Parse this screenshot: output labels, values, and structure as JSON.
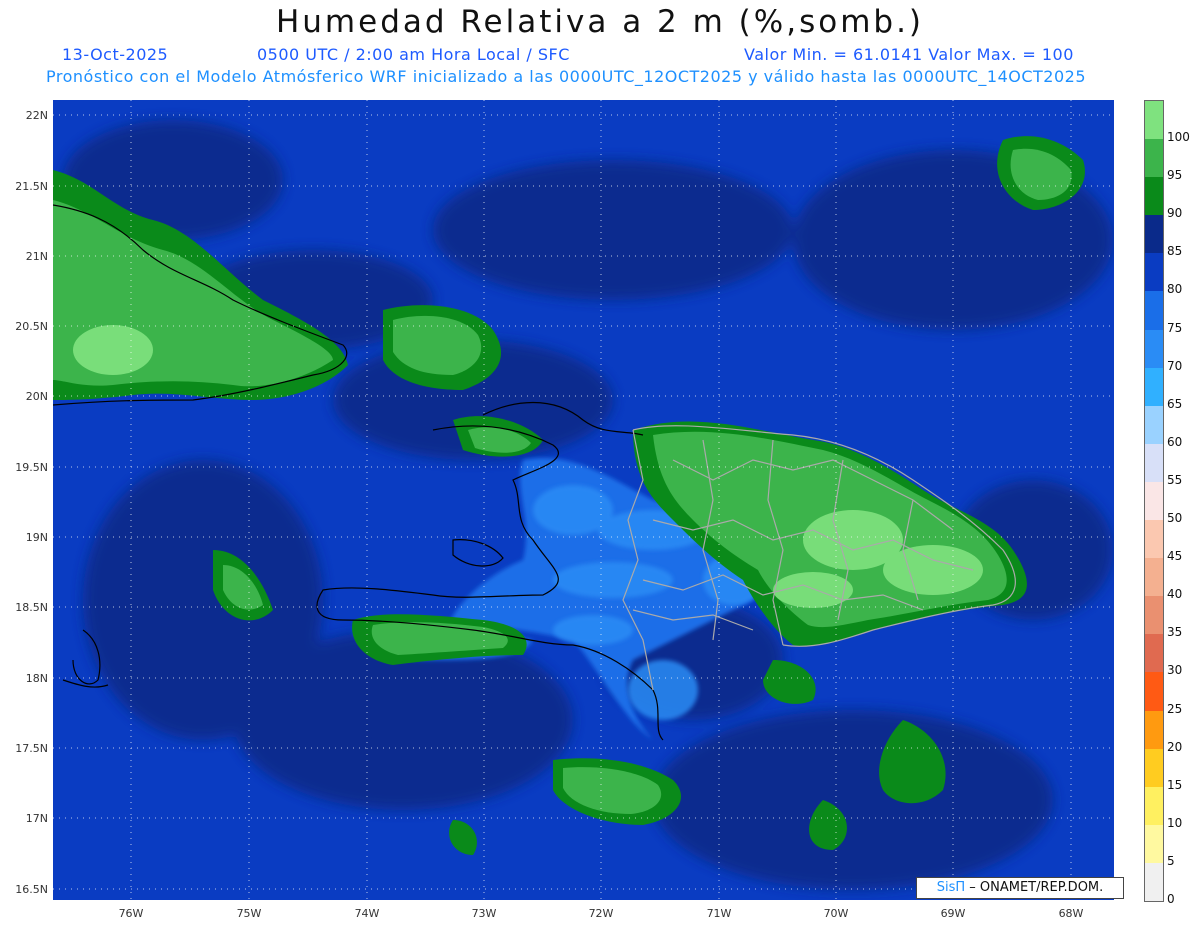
{
  "header": {
    "title": "Humedad Relativa a 2 m (%,somb.)",
    "date": "13-Oct-2025",
    "time_info": "0500 UTC / 2:00 am Hora Local / SFC",
    "min_max": "Valor Min. = 61.0141  Valor Max. = 100",
    "model_info": "Pronóstico con el Modelo Atmósferico WRF inicializado a las 0000UTC_12OCT2025 y válido hasta las  0000UTC_14OCT2025"
  },
  "axes": {
    "lat_labels": [
      "22N",
      "21.5N",
      "21N",
      "20.5N",
      "20N",
      "19.5N",
      "19N",
      "18.5N",
      "18N",
      "17.5N",
      "17N",
      "16.5N"
    ],
    "lon_labels": [
      "76W",
      "75W",
      "74W",
      "73W",
      "72W",
      "71W",
      "70W",
      "69W",
      "68W"
    ]
  },
  "legend": {
    "labels": [
      "100",
      "95",
      "90",
      "85",
      "80",
      "75",
      "70",
      "65",
      "60",
      "55",
      "50",
      "45",
      "40",
      "35",
      "30",
      "25",
      "20",
      "15",
      "10",
      "5",
      "0"
    ],
    "colors": [
      "#7fe27f",
      "#3cb44b",
      "#0a8a1a",
      "#0a2a8a",
      "#0a3cc2",
      "#1a6ee8",
      "#2a8cf5",
      "#30b0ff",
      "#9ad2ff",
      "#d8e0f8",
      "#fae6e6",
      "#fbc8b0",
      "#f4b090",
      "#ea9070",
      "#e06a50",
      "#ff5a14",
      "#ff9a10",
      "#ffcc20",
      "#fff060",
      "#fff9a0",
      "#f0f0f0"
    ]
  },
  "credit": {
    "sis": "SisΠ",
    "org": " – ONAMET/REP.DOM."
  },
  "colors": {
    "ocean": "#0a3cc2",
    "dark_band": "#0a2a8a",
    "mid_blue": "#1a6ee8",
    "light_blue": "#2a8cf5",
    "green": "#3cb44b",
    "dark_green": "#0a8a1a",
    "light_green": "#7fe27f"
  }
}
